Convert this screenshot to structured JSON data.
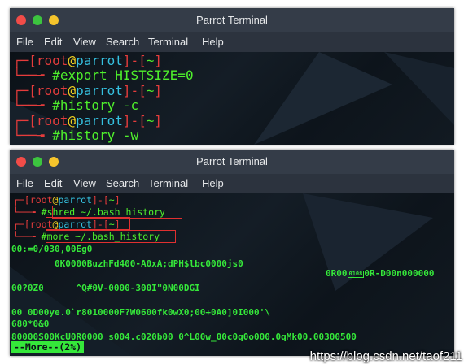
{
  "window1": {
    "title": "Parrot Terminal",
    "menu": [
      "File",
      "Edit",
      "View",
      "Search",
      "Terminal",
      "Help"
    ],
    "prompt": {
      "bracket_open": "[",
      "user": "root",
      "at": "@",
      "host": "parrot",
      "sep": "]-[",
      "dir": "~",
      "bracket_close": "]"
    },
    "commands": [
      "export HISTSIZE=0",
      "history -c",
      "history -w"
    ]
  },
  "window2": {
    "title": "Parrot Terminal",
    "menu": [
      "File",
      "Edit",
      "View",
      "Search",
      "Terminal",
      "Help"
    ],
    "commands": [
      "shred ~/.bash_history",
      "more ~/.bash_history"
    ],
    "dump_lines": [
      "00:=0/030,00Eg0",
      "        0K0000BuzhFd400-A0xA;dPH$lbc0000js0",
      "0R00",
      "0R-D00n000000",
      "00?0Z0      ^Q#0V-0000-300I\"0N00DGI",
      "00 0D00ye.0`r8010000F?W0600fk0wX0;00+0A0]0I000'\\",
      "680*0&0",
      "80000S00KcU0R0000 s004.c020b00 0^L00w_00c0q0o000.0qMk00.00300500"
    ],
    "boxed_glyph": "0108",
    "pager_status": "--More--(2%)"
  },
  "watermark": "https://blog.csdn.net/taof211",
  "colors": {
    "prompt_red": "#e53c3c",
    "host_cyan": "#35c1e0",
    "at_yellow": "#f0d020",
    "command_green": "#4ff02c",
    "dump_green": "#35e83a",
    "titlebar": "#343c48",
    "highlight_box": "#e03030"
  }
}
